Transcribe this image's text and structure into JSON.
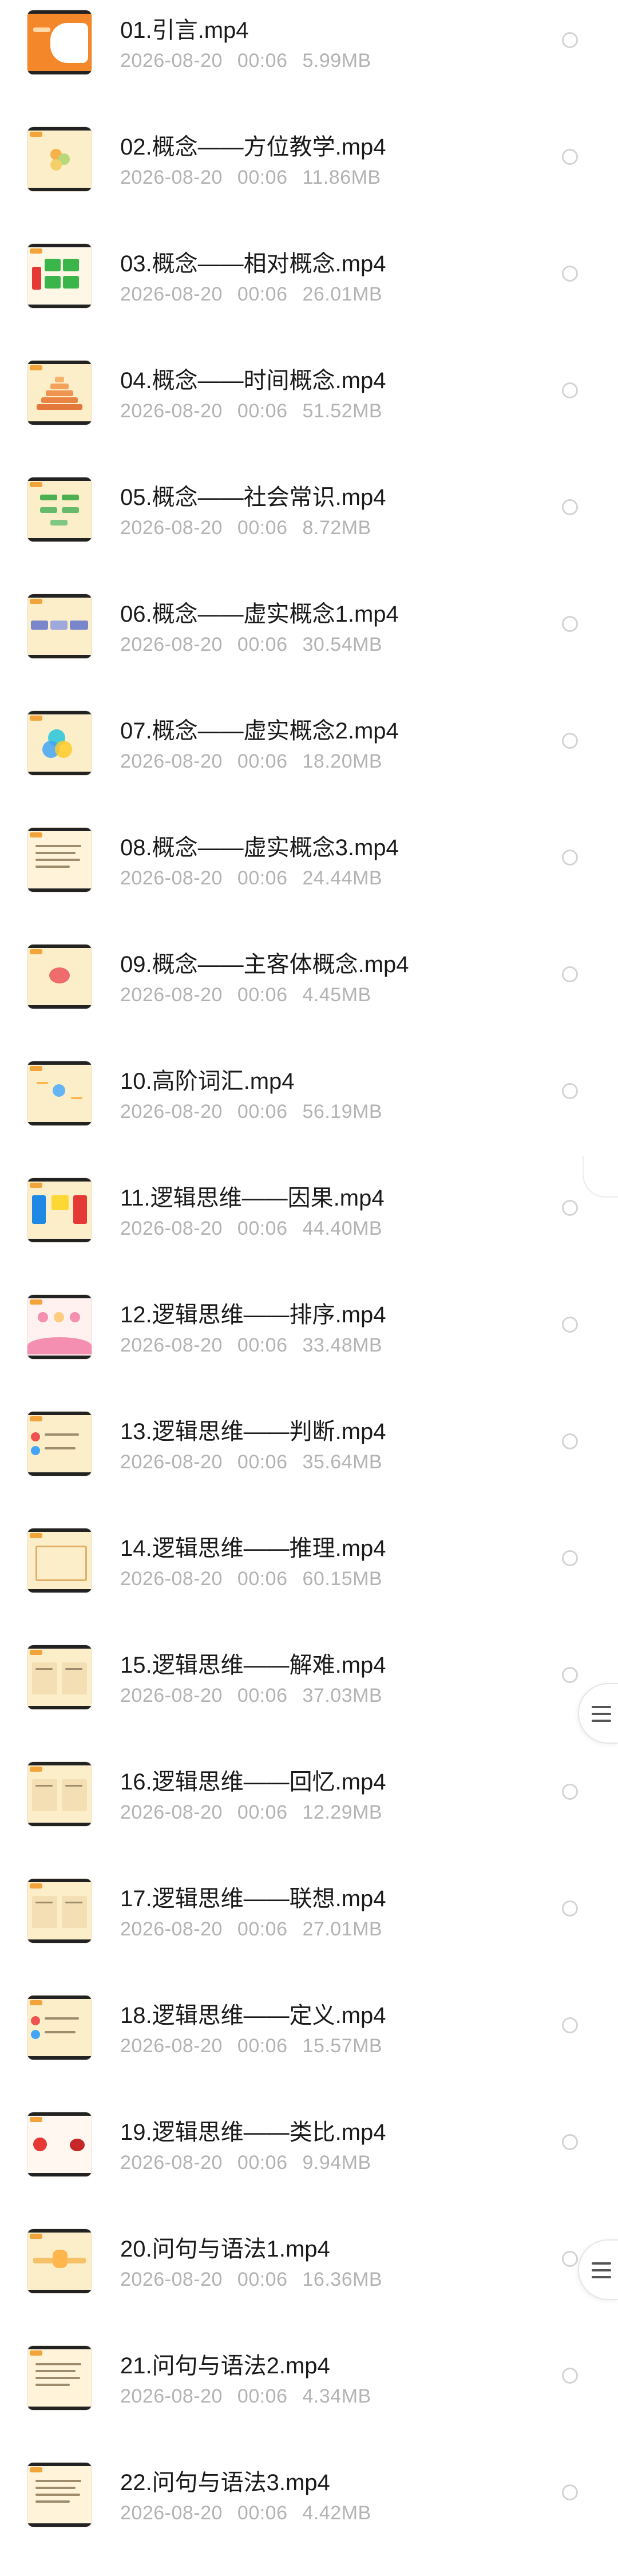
{
  "files": [
    {
      "name": "01.引言.mp4",
      "date": "2026-08-20",
      "time": "00:06",
      "size": "5.99MB",
      "thumb": "orange"
    },
    {
      "name": "02.概念——方位教学.mp4",
      "date": "2026-08-20",
      "time": "00:06",
      "size": "11.86MB",
      "thumb": "circles"
    },
    {
      "name": "03.概念——相对概念.mp4",
      "date": "2026-08-20",
      "time": "00:06",
      "size": "26.01MB",
      "thumb": "grid"
    },
    {
      "name": "04.概念——时间概念.mp4",
      "date": "2026-08-20",
      "time": "00:06",
      "size": "51.52MB",
      "thumb": "pyramid"
    },
    {
      "name": "05.概念——社会常识.mp4",
      "date": "2026-08-20",
      "time": "00:06",
      "size": "8.72MB",
      "thumb": "green"
    },
    {
      "name": "06.概念——虚实概念1.mp4",
      "date": "2026-08-20",
      "time": "00:06",
      "size": "30.54MB",
      "thumb": "blue"
    },
    {
      "name": "07.概念——虚实概念2.mp4",
      "date": "2026-08-20",
      "time": "00:06",
      "size": "18.20MB",
      "thumb": "venn"
    },
    {
      "name": "08.概念——虚实概念3.mp4",
      "date": "2026-08-20",
      "time": "00:06",
      "size": "24.44MB",
      "thumb": "text"
    },
    {
      "name": "09.概念——主客体概念.mp4",
      "date": "2026-08-20",
      "time": "00:06",
      "size": "4.45MB",
      "thumb": "center"
    },
    {
      "name": "10.高阶词汇.mp4",
      "date": "2026-08-20",
      "time": "00:06",
      "size": "56.19MB",
      "thumb": "mind"
    },
    {
      "name": "11.逻辑思维——因果.mp4",
      "date": "2026-08-20",
      "time": "00:06",
      "size": "44.40MB",
      "thumb": "cause"
    },
    {
      "name": "12.逻辑思维——排序.mp4",
      "date": "2026-08-20",
      "time": "00:06",
      "size": "33.48MB",
      "thumb": "sort"
    },
    {
      "name": "13.逻辑思维——判断.mp4",
      "date": "2026-08-20",
      "time": "00:06",
      "size": "35.64MB",
      "thumb": "judge"
    },
    {
      "name": "14.逻辑思维——推理.mp4",
      "date": "2026-08-20",
      "time": "00:06",
      "size": "60.15MB",
      "thumb": "frame"
    },
    {
      "name": "15.逻辑思维——解难.mp4",
      "date": "2026-08-20",
      "time": "00:06",
      "size": "37.03MB",
      "thumb": "split"
    },
    {
      "name": "16.逻辑思维——回忆.mp4",
      "date": "2026-08-20",
      "time": "00:06",
      "size": "12.29MB",
      "thumb": "split"
    },
    {
      "name": "17.逻辑思维——联想.mp4",
      "date": "2026-08-20",
      "time": "00:06",
      "size": "27.01MB",
      "thumb": "split"
    },
    {
      "name": "18.逻辑思维——定义.mp4",
      "date": "2026-08-20",
      "time": "00:06",
      "size": "15.57MB",
      "thumb": "judge"
    },
    {
      "name": "19.逻辑思维——类比.mp4",
      "date": "2026-08-20",
      "time": "00:06",
      "size": "9.94MB",
      "thumb": "fruit"
    },
    {
      "name": "20.问句与语法1.mp4",
      "date": "2026-08-20",
      "time": "00:06",
      "size": "16.36MB",
      "thumb": "stripe"
    },
    {
      "name": "21.问句与语法2.mp4",
      "date": "2026-08-20",
      "time": "00:06",
      "size": "4.34MB",
      "thumb": "text"
    },
    {
      "name": "22.问句与语法3.mp4",
      "date": "2026-08-20",
      "time": "00:06",
      "size": "4.42MB",
      "thumb": "text"
    }
  ],
  "icons": {
    "scroll_handle": "hamburger-icon",
    "select": "radio-circle-icon"
  },
  "colors": {
    "title": "#1a1a1a",
    "meta": "#b3b3b3",
    "radio_border": "#d4d4d4",
    "thumb_bg": "#fbeec9",
    "thumb_accent": "#f2a33a"
  }
}
